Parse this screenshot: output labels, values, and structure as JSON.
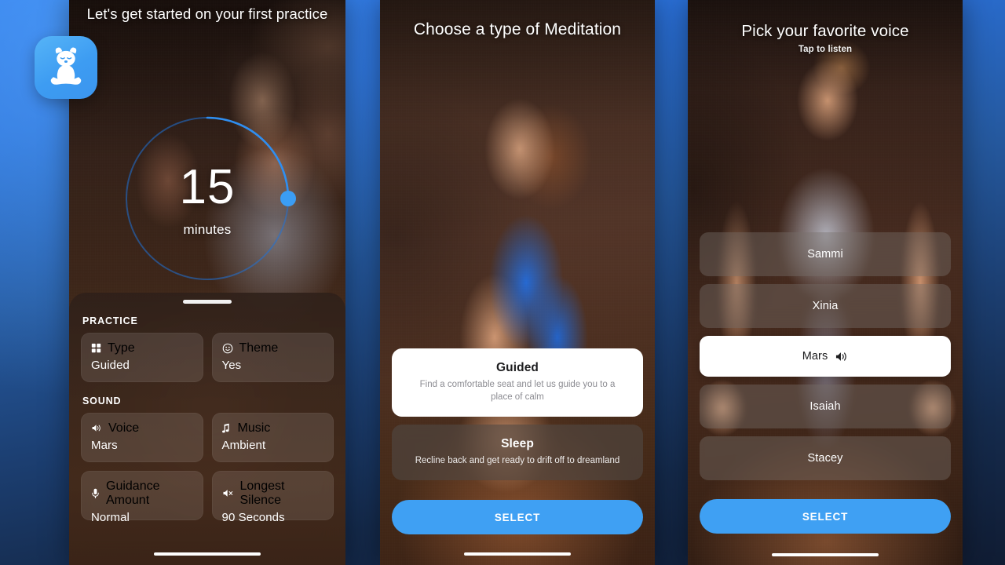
{
  "theme": {
    "accent_blue": "#3FA0F3",
    "accent_blue_light": "#56B4F7",
    "bg_gradient_top": "#2F7AE8",
    "bg_gradient_bottom": "#101C33",
    "card_white": "#FFFFFF",
    "text_white": "#FFFFFF",
    "text_muted_dark": "#8C8C92"
  },
  "app_icon": {
    "name": "meditating-dog-icon",
    "background": "#3D9CF2"
  },
  "screen_1": {
    "title": "Let's get started on your first practice",
    "timer": {
      "value": "15",
      "unit": "minutes",
      "knob_position_deg": 90,
      "min": 1,
      "max": 60
    },
    "sections": [
      {
        "label": "PRACTICE",
        "cards": [
          {
            "icon": "grid-icon",
            "key": "Type",
            "value": "Guided"
          },
          {
            "icon": "smiley-icon",
            "key": "Theme",
            "value": "Yes"
          }
        ]
      },
      {
        "label": "SOUND",
        "cards": [
          {
            "icon": "speaker-icon",
            "key": "Voice",
            "value": "Mars"
          },
          {
            "icon": "music-note-icon",
            "key": "Music",
            "value": "Ambient"
          },
          {
            "icon": "microphone-icon",
            "key": "Guidance Amount",
            "value": "Normal"
          },
          {
            "icon": "speaker-mute-icon",
            "key": "Longest Silence",
            "value": "90 Seconds"
          }
        ]
      }
    ]
  },
  "screen_2": {
    "title": "Choose a type of Meditation",
    "options": [
      {
        "name": "Guided",
        "description": "Find a comfortable seat and let us guide you to a place of calm",
        "selected": true
      },
      {
        "name": "Sleep",
        "description": "Recline back and get ready to drift off to dreamland",
        "selected": false
      }
    ],
    "select_label": "SELECT"
  },
  "screen_3": {
    "title": "Pick your favorite voice",
    "subtitle": "Tap to listen",
    "voices": [
      {
        "name": "Sammi",
        "selected": false
      },
      {
        "name": "Xinia",
        "selected": false
      },
      {
        "name": "Mars",
        "selected": true
      },
      {
        "name": "Isaiah",
        "selected": false
      },
      {
        "name": "Stacey",
        "selected": false
      }
    ],
    "select_label": "SELECT"
  }
}
